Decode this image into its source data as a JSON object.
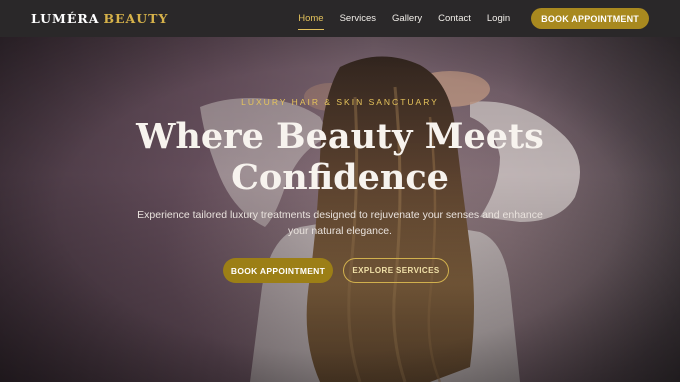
{
  "nav": {
    "logo_main": "LUMÉRA",
    "logo_accent": "BEAUTY",
    "links": [
      {
        "label": "Home"
      },
      {
        "label": "Services"
      },
      {
        "label": "Gallery"
      },
      {
        "label": "Contact"
      },
      {
        "label": "Login"
      }
    ],
    "cta_label": "BOOK APPOINTMENT"
  },
  "hero": {
    "eyebrow": "LUXURY HAIR & SKIN SANCTUARY",
    "headline_line1": "Where Beauty Meets",
    "headline_line2": "Confidence",
    "subtext_line1": "Experience tailored luxury treatments designed to rejuvenate your senses and enhance",
    "subtext_line2": "your natural elegance.",
    "primary_button": "BOOK APPOINTMENT",
    "secondary_button": "EXPLORE SERVICES"
  },
  "colors": {
    "accent_gold": "#d6b24a",
    "button_gold": "#a8891f",
    "nav_bg": "#2a2829"
  },
  "icons": []
}
